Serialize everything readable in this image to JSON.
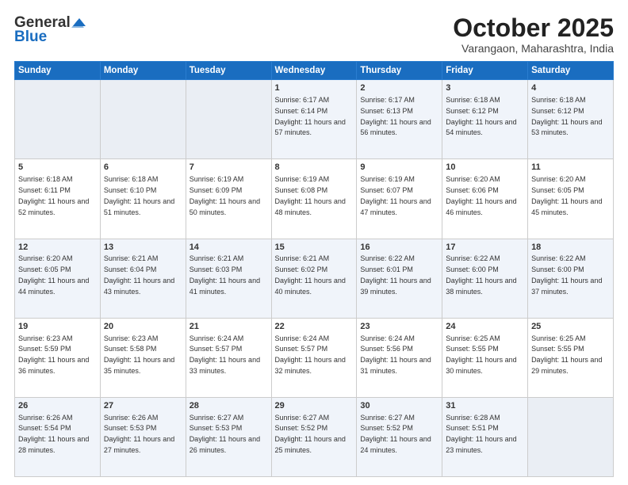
{
  "header": {
    "logo_general": "General",
    "logo_blue": "Blue",
    "month_title": "October 2025",
    "location": "Varangaon, Maharashtra, India"
  },
  "days_header": [
    "Sunday",
    "Monday",
    "Tuesday",
    "Wednesday",
    "Thursday",
    "Friday",
    "Saturday"
  ],
  "weeks": [
    {
      "cells": [
        {
          "day": "",
          "info": ""
        },
        {
          "day": "",
          "info": ""
        },
        {
          "day": "",
          "info": ""
        },
        {
          "day": "1",
          "info": "Sunrise: 6:17 AM\nSunset: 6:14 PM\nDaylight: 11 hours and 57 minutes."
        },
        {
          "day": "2",
          "info": "Sunrise: 6:17 AM\nSunset: 6:13 PM\nDaylight: 11 hours and 56 minutes."
        },
        {
          "day": "3",
          "info": "Sunrise: 6:18 AM\nSunset: 6:12 PM\nDaylight: 11 hours and 54 minutes."
        },
        {
          "day": "4",
          "info": "Sunrise: 6:18 AM\nSunset: 6:12 PM\nDaylight: 11 hours and 53 minutes."
        }
      ]
    },
    {
      "cells": [
        {
          "day": "5",
          "info": "Sunrise: 6:18 AM\nSunset: 6:11 PM\nDaylight: 11 hours and 52 minutes."
        },
        {
          "day": "6",
          "info": "Sunrise: 6:18 AM\nSunset: 6:10 PM\nDaylight: 11 hours and 51 minutes."
        },
        {
          "day": "7",
          "info": "Sunrise: 6:19 AM\nSunset: 6:09 PM\nDaylight: 11 hours and 50 minutes."
        },
        {
          "day": "8",
          "info": "Sunrise: 6:19 AM\nSunset: 6:08 PM\nDaylight: 11 hours and 48 minutes."
        },
        {
          "day": "9",
          "info": "Sunrise: 6:19 AM\nSunset: 6:07 PM\nDaylight: 11 hours and 47 minutes."
        },
        {
          "day": "10",
          "info": "Sunrise: 6:20 AM\nSunset: 6:06 PM\nDaylight: 11 hours and 46 minutes."
        },
        {
          "day": "11",
          "info": "Sunrise: 6:20 AM\nSunset: 6:05 PM\nDaylight: 11 hours and 45 minutes."
        }
      ]
    },
    {
      "cells": [
        {
          "day": "12",
          "info": "Sunrise: 6:20 AM\nSunset: 6:05 PM\nDaylight: 11 hours and 44 minutes."
        },
        {
          "day": "13",
          "info": "Sunrise: 6:21 AM\nSunset: 6:04 PM\nDaylight: 11 hours and 43 minutes."
        },
        {
          "day": "14",
          "info": "Sunrise: 6:21 AM\nSunset: 6:03 PM\nDaylight: 11 hours and 41 minutes."
        },
        {
          "day": "15",
          "info": "Sunrise: 6:21 AM\nSunset: 6:02 PM\nDaylight: 11 hours and 40 minutes."
        },
        {
          "day": "16",
          "info": "Sunrise: 6:22 AM\nSunset: 6:01 PM\nDaylight: 11 hours and 39 minutes."
        },
        {
          "day": "17",
          "info": "Sunrise: 6:22 AM\nSunset: 6:00 PM\nDaylight: 11 hours and 38 minutes."
        },
        {
          "day": "18",
          "info": "Sunrise: 6:22 AM\nSunset: 6:00 PM\nDaylight: 11 hours and 37 minutes."
        }
      ]
    },
    {
      "cells": [
        {
          "day": "19",
          "info": "Sunrise: 6:23 AM\nSunset: 5:59 PM\nDaylight: 11 hours and 36 minutes."
        },
        {
          "day": "20",
          "info": "Sunrise: 6:23 AM\nSunset: 5:58 PM\nDaylight: 11 hours and 35 minutes."
        },
        {
          "day": "21",
          "info": "Sunrise: 6:24 AM\nSunset: 5:57 PM\nDaylight: 11 hours and 33 minutes."
        },
        {
          "day": "22",
          "info": "Sunrise: 6:24 AM\nSunset: 5:57 PM\nDaylight: 11 hours and 32 minutes."
        },
        {
          "day": "23",
          "info": "Sunrise: 6:24 AM\nSunset: 5:56 PM\nDaylight: 11 hours and 31 minutes."
        },
        {
          "day": "24",
          "info": "Sunrise: 6:25 AM\nSunset: 5:55 PM\nDaylight: 11 hours and 30 minutes."
        },
        {
          "day": "25",
          "info": "Sunrise: 6:25 AM\nSunset: 5:55 PM\nDaylight: 11 hours and 29 minutes."
        }
      ]
    },
    {
      "cells": [
        {
          "day": "26",
          "info": "Sunrise: 6:26 AM\nSunset: 5:54 PM\nDaylight: 11 hours and 28 minutes."
        },
        {
          "day": "27",
          "info": "Sunrise: 6:26 AM\nSunset: 5:53 PM\nDaylight: 11 hours and 27 minutes."
        },
        {
          "day": "28",
          "info": "Sunrise: 6:27 AM\nSunset: 5:53 PM\nDaylight: 11 hours and 26 minutes."
        },
        {
          "day": "29",
          "info": "Sunrise: 6:27 AM\nSunset: 5:52 PM\nDaylight: 11 hours and 25 minutes."
        },
        {
          "day": "30",
          "info": "Sunrise: 6:27 AM\nSunset: 5:52 PM\nDaylight: 11 hours and 24 minutes."
        },
        {
          "day": "31",
          "info": "Sunrise: 6:28 AM\nSunset: 5:51 PM\nDaylight: 11 hours and 23 minutes."
        },
        {
          "day": "",
          "info": ""
        }
      ]
    }
  ]
}
